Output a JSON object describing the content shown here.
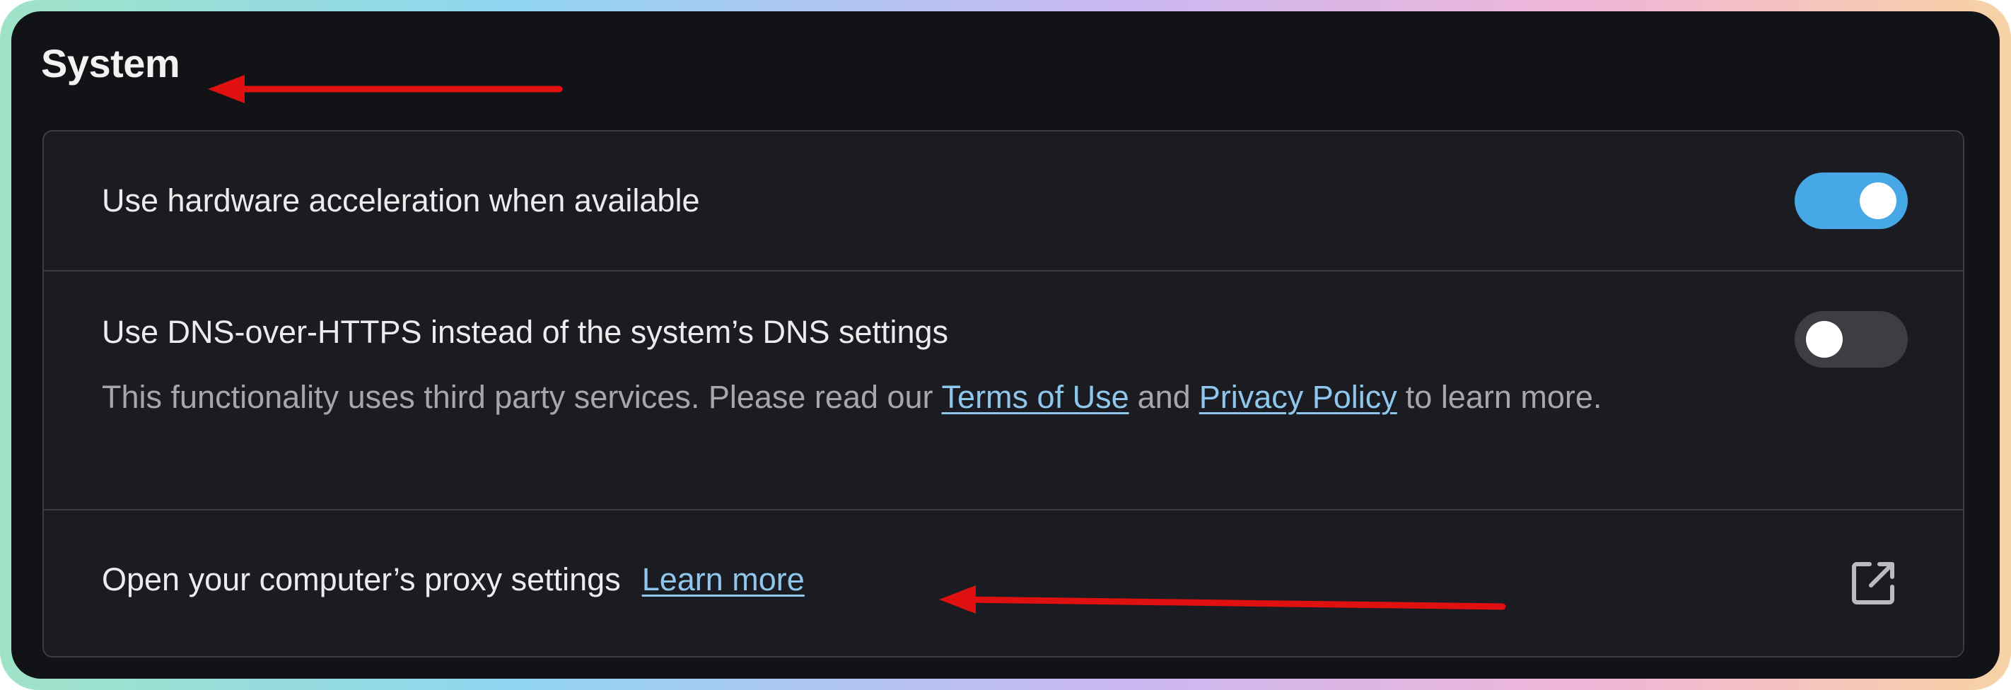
{
  "section": {
    "title": "System"
  },
  "rows": {
    "hardware": {
      "label": "Use hardware acceleration when available",
      "toggle_on": true
    },
    "dns": {
      "label": "Use DNS-over-HTTPS instead of the system’s DNS settings",
      "desc_before": "This functionality uses third party services. Please read our",
      "terms_link": "Terms of Use",
      "desc_and": "and",
      "privacy_link": "Privacy Policy",
      "desc_after": "to learn more.",
      "toggle_on": false
    },
    "proxy": {
      "label": "Open your computer’s proxy settings",
      "learn_link": "Learn more",
      "icon": "external-link-icon"
    }
  },
  "colors": {
    "background": "#121317",
    "card": "#1a1c21",
    "toggle_on": "#47a8e6",
    "toggle_off": "#3c3e44",
    "link": "#8fc7ec",
    "annotation_arrow": "#e01010"
  }
}
